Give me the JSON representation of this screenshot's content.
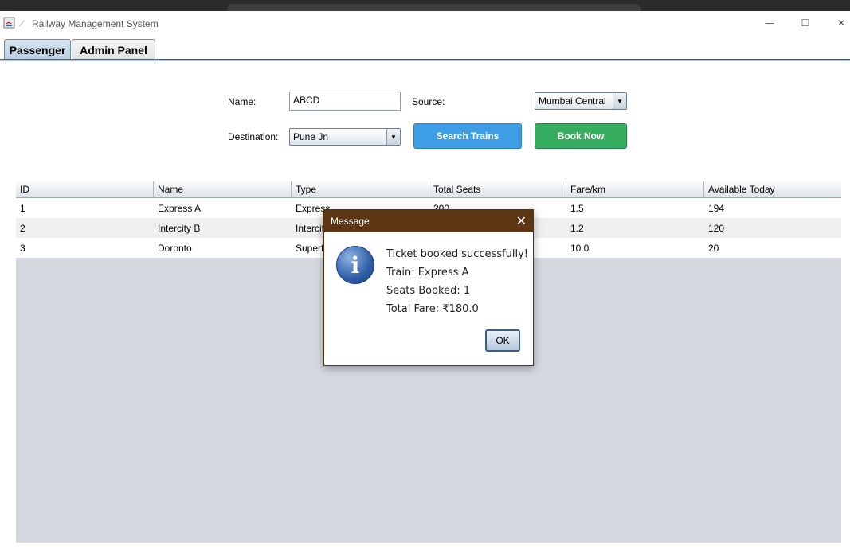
{
  "window": {
    "title": "Railway Management System",
    "controls": {
      "minimize": "—",
      "maximize": "☐",
      "close": "✕"
    }
  },
  "tabs": [
    {
      "label": "Passenger",
      "active": true
    },
    {
      "label": "Admin Panel",
      "active": false
    }
  ],
  "form": {
    "name_label": "Name:",
    "name_value": "ABCD",
    "source_label": "Source:",
    "source_value": "Mumbai Central",
    "destination_label": "Destination:",
    "destination_value": "Pune Jn",
    "search_button": "Search Trains",
    "book_button": "Book Now",
    "dropdown_arrow": "▼"
  },
  "table": {
    "columns": [
      "ID",
      "Name",
      "Type",
      "Total Seats",
      "Fare/km",
      "Available Today"
    ],
    "rows": [
      [
        "1",
        "Express A",
        "Express",
        "200",
        "1.5",
        "194"
      ],
      [
        "2",
        "Intercity B",
        "Intercity",
        "",
        "1.2",
        "120"
      ],
      [
        "3",
        "Doronto",
        "Superfast",
        "",
        "10.0",
        "20"
      ]
    ]
  },
  "dialog": {
    "title": "Message",
    "close_glyph": "✕",
    "icon": "info-icon",
    "icon_glyph": "i",
    "lines": [
      "Ticket booked successfully!",
      "Train: Express A",
      "Seats Booked: 1",
      "Total Fare: ₹180.0"
    ],
    "ok_label": "OK"
  },
  "colors": {
    "dialog_titlebar": "#5c3512",
    "search_button": "#3d9ee6",
    "book_button": "#37ad5f",
    "table_background": "#d5d8df"
  }
}
